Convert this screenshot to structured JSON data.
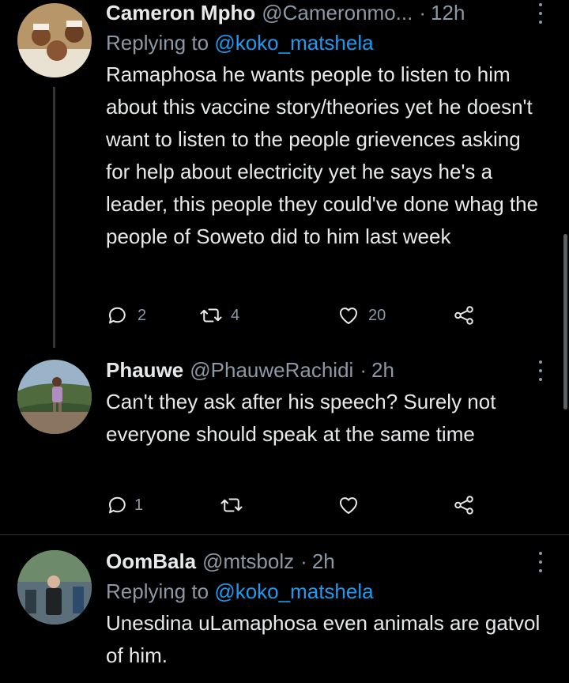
{
  "tweets": [
    {
      "name": "Cameron Mpho",
      "handle": "@Cameronmo...",
      "time": "12h",
      "replying_label": "Replying to",
      "replying_to": "@koko_matshela",
      "text": "Ramaphosa he wants people to listen to him about this vaccine story/theories yet he doesn't want to listen to the people grievences asking for help about electricity yet he says he's a leader, this people they could've done whag the people of Soweto did to him last week",
      "reply_count": "2",
      "retweet_count": "4",
      "like_count": "20"
    },
    {
      "name": "Phauwe",
      "handle": "@PhauweRachidi",
      "time": "2h",
      "text": "Can't they ask after his speech? Surely not everyone should speak at the same time",
      "reply_count": "1",
      "retweet_count": "",
      "like_count": ""
    },
    {
      "name": "OomBala",
      "handle": "@mtsbolz",
      "time": "2h",
      "replying_label": "Replying to",
      "replying_to": "@koko_matshela",
      "text": "Unesdina uLamaphosa even animals are gatvol of him."
    }
  ],
  "separator": "·",
  "colors": {
    "background": "#000000",
    "text": "#e7e9ea",
    "secondary": "#8b98a5",
    "link": "#1d9bf0"
  }
}
